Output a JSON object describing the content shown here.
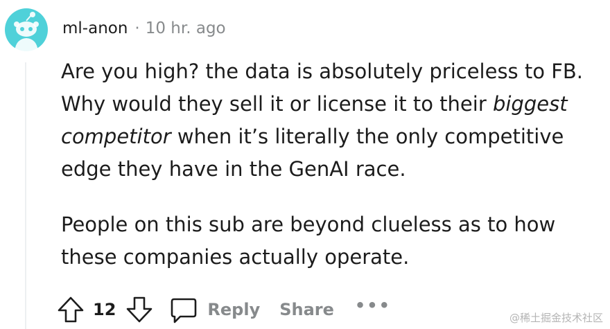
{
  "comment": {
    "username": "ml-anon",
    "separator": "·",
    "time": "10 hr. ago",
    "paragraph1": {
      "part1": "Are you high? the data is absolutely priceless to FB. Why would they sell it or license it to their ",
      "italic1": "biggest competitor",
      "part2": " when it’s literally the only competitive edge they have in the GenAI race."
    },
    "paragraph2": "People on this sub are beyond clueless as to how these companies actually operate.",
    "vote_count": "12",
    "reply_label": "Reply",
    "share_label": "Share",
    "more_label": "•••"
  },
  "watermark": "@稀土掘金技术社区",
  "colors": {
    "avatar_bg": "#4fd1d9",
    "text": "#1c1c1c",
    "muted": "#878a8c",
    "thread_line": "#edeff1"
  },
  "icons": {
    "avatar": "reddit-snoo-icon",
    "upvote": "upvote-arrow-icon",
    "downvote": "downvote-arrow-icon",
    "reply": "comment-bubble-icon",
    "more": "more-options-icon"
  }
}
